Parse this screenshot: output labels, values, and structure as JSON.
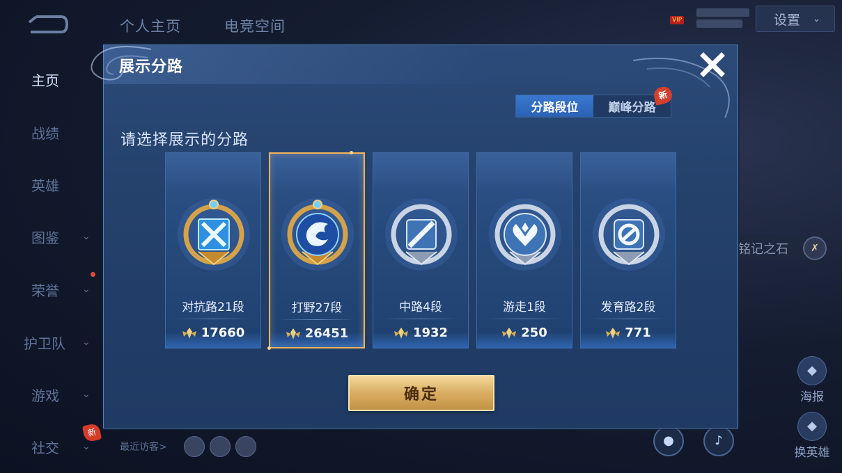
{
  "background": {
    "top_tabs": [
      "个人主页",
      "电竞空间"
    ],
    "sidebar": [
      {
        "label": "主页",
        "active": true,
        "chevron": false
      },
      {
        "label": "战绩",
        "active": false,
        "chevron": false
      },
      {
        "label": "英雄",
        "active": false,
        "chevron": false
      },
      {
        "label": "图鉴",
        "active": false,
        "chevron": true
      },
      {
        "label": "荣誉",
        "active": false,
        "chevron": true
      },
      {
        "label": "护卫队",
        "active": false,
        "chevron": true
      },
      {
        "label": "游戏",
        "active": false,
        "chevron": true
      },
      {
        "label": "社交",
        "active": false,
        "chevron": true
      }
    ],
    "new_tag": "新",
    "settings_label": "设置",
    "vip_label": "VIP",
    "stone_label": "铭记之石",
    "poster_label": "海报",
    "swap_hero_label": "换英雄",
    "visitors_label": "最近访客>"
  },
  "dialog": {
    "title": "展示分路",
    "tabs": [
      {
        "label": "分路段位",
        "active": true
      },
      {
        "label": "巅峰分路",
        "active": false
      }
    ],
    "new_badge": "新",
    "prompt": "请选择展示的分路",
    "lanes": [
      {
        "rank": "对抗路21段",
        "points": "17660",
        "selected": false,
        "badge_tier": "gold",
        "emblem": "crossed-swords-icon"
      },
      {
        "rank": "打野27段",
        "points": "26451",
        "selected": true,
        "badge_tier": "gold",
        "emblem": "dragon-icon"
      },
      {
        "rank": "中路4段",
        "points": "1932",
        "selected": false,
        "badge_tier": "silver",
        "emblem": "slash-icon"
      },
      {
        "rank": "游走1段",
        "points": "250",
        "selected": false,
        "badge_tier": "silver",
        "emblem": "wings-icon"
      },
      {
        "rank": "发育路2段",
        "points": "771",
        "selected": false,
        "badge_tier": "silver",
        "emblem": "arrow-circle-icon"
      }
    ],
    "confirm_label": "确定"
  },
  "colors": {
    "accent_blue": "#2b62b4",
    "selected_border": "#f0b45a",
    "confirm_gold": "#d9ae62",
    "new_tag_red": "#d3402d"
  }
}
